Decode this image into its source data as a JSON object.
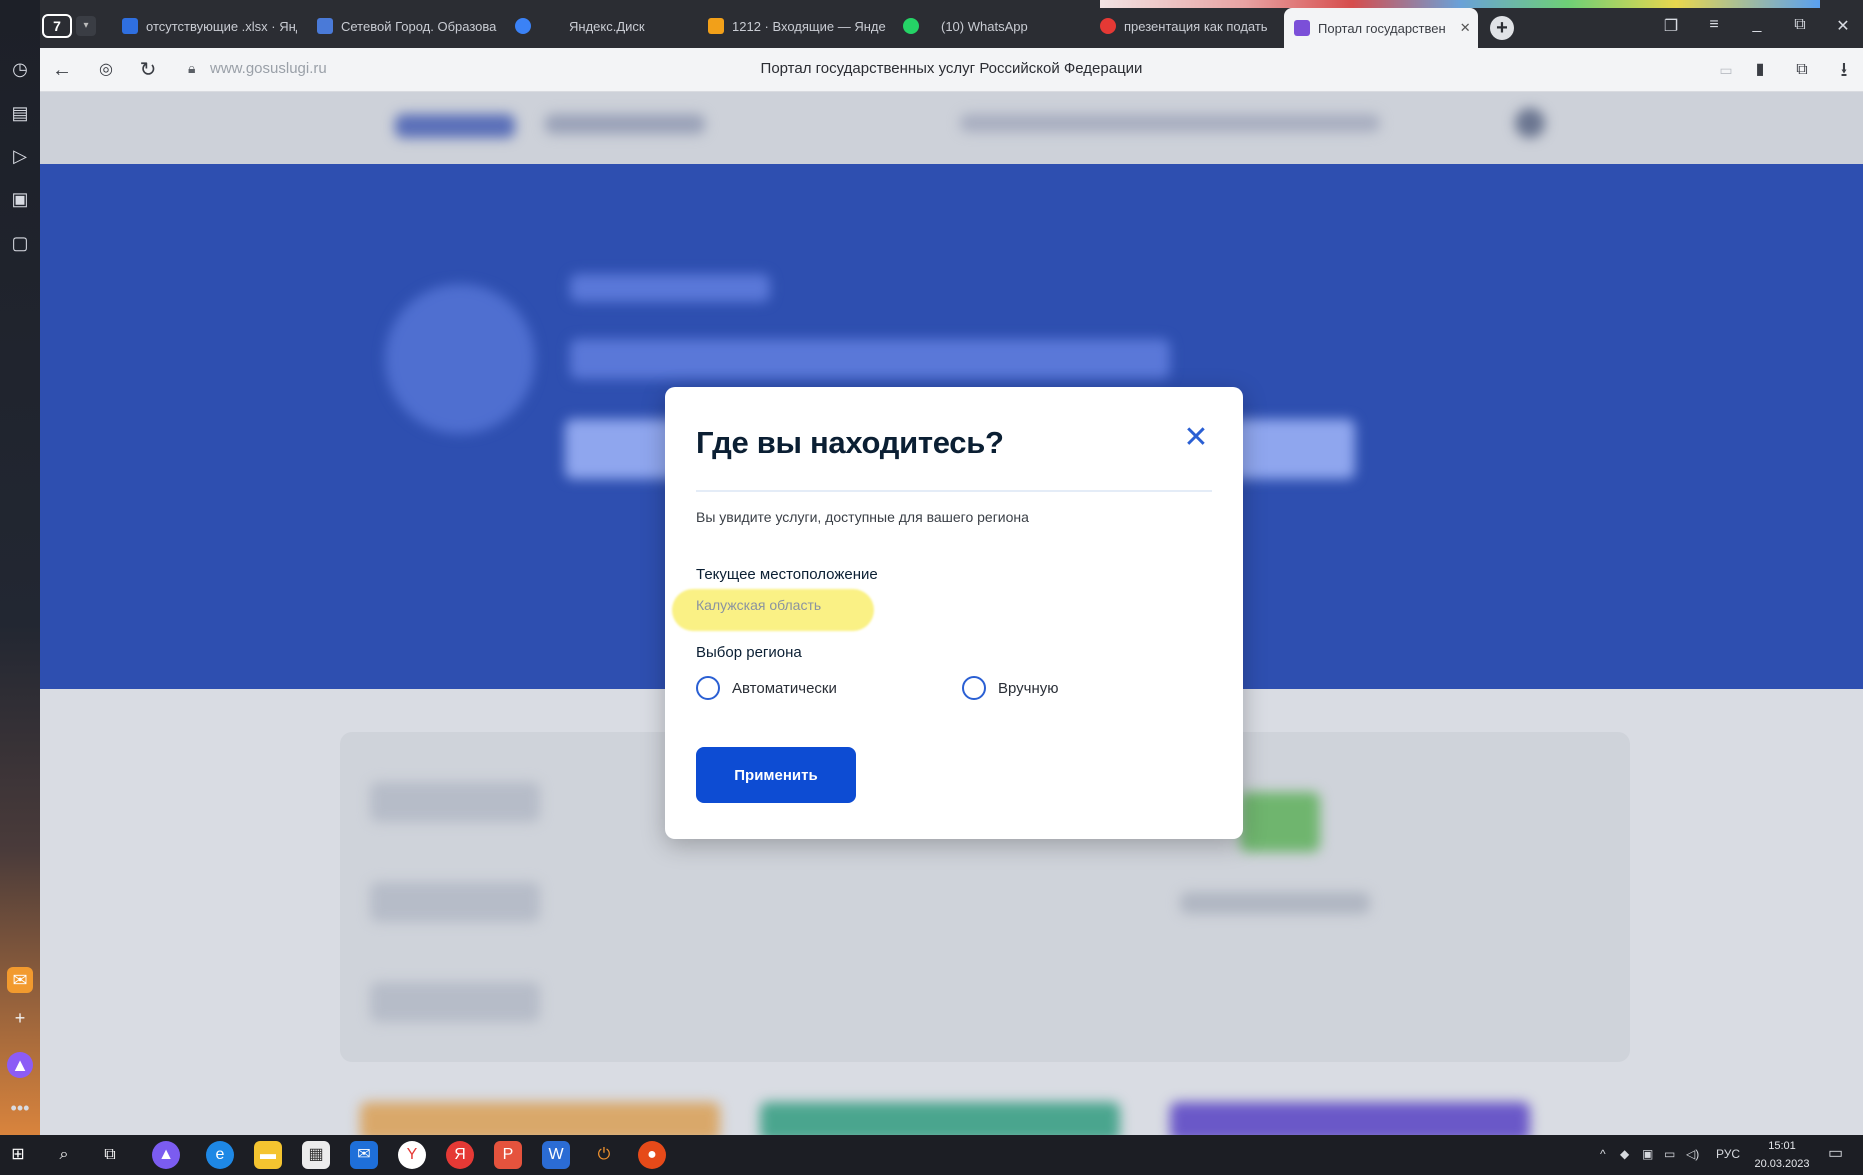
{
  "browser": {
    "tab_counter": "7",
    "tabs": [
      {
        "label": "отсутствующие .xlsx · Янд",
        "color": "#2f6fe0"
      },
      {
        "label": "Сетевой Город. Образова",
        "color": "#4a7ad8"
      },
      {
        "label": "Яндекс.Диск",
        "color": "#3b82f6"
      },
      {
        "label": "1212 · Входящие — Янде",
        "color": "#f2a019"
      },
      {
        "label": "(10) WhatsApp",
        "color": "#25d366"
      },
      {
        "label": "презентация как подать",
        "color": "#e53935"
      },
      {
        "label": "Портал государствен",
        "color": "#7b4fd8"
      }
    ],
    "address": "www.gosuslugi.ru",
    "page_title": "Портал государственных услуг Российской Федерации"
  },
  "dialog": {
    "title": "Где вы находитесь?",
    "description": "Вы увидите услуги, доступные для вашего региона",
    "current_location_label": "Текущее местоположение",
    "current_location_value": "Калужская область",
    "region_choice_label": "Выбор региона",
    "options": [
      {
        "label": "Автоматически",
        "selected": false
      },
      {
        "label": "Вручную",
        "selected": false
      }
    ],
    "apply_label": "Применить",
    "accent_color": "#0d4cd3",
    "highlight_color": "#f8ec5c"
  },
  "taskbar": {
    "language": "РУС",
    "time": "15:01",
    "date": "20.03.2023"
  }
}
